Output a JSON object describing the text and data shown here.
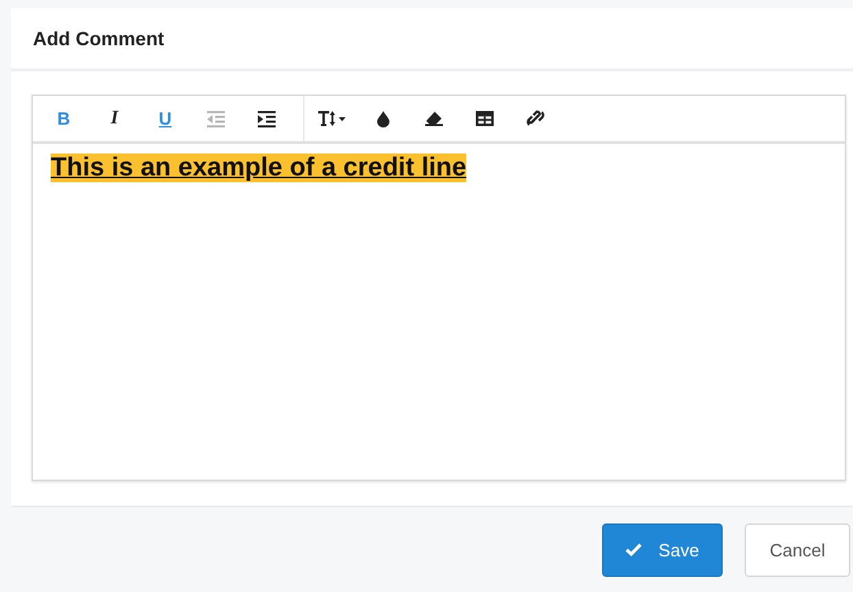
{
  "dialog": {
    "title": "Add Comment"
  },
  "toolbar": {
    "groups": [
      [
        {
          "kind": "bold",
          "label": "B",
          "active": true,
          "disabled": false
        },
        {
          "kind": "italic",
          "label": "I",
          "active": false,
          "disabled": false
        },
        {
          "kind": "underline",
          "label": "U",
          "active": true,
          "disabled": false
        },
        {
          "kind": "outdent",
          "active": false,
          "disabled": true
        },
        {
          "kind": "indent",
          "active": false,
          "disabled": false
        }
      ],
      [
        {
          "kind": "font-size",
          "active": false,
          "disabled": false
        },
        {
          "kind": "color",
          "active": false,
          "disabled": false
        },
        {
          "kind": "eraser",
          "active": false,
          "disabled": false
        },
        {
          "kind": "table",
          "active": false,
          "disabled": false
        },
        {
          "kind": "link",
          "active": false,
          "disabled": false
        }
      ]
    ]
  },
  "editor": {
    "text": "This is an example of a credit line",
    "highlighted": true
  },
  "buttons": [
    {
      "kind": "primary",
      "label": "Save"
    },
    {
      "kind": "secondary",
      "label": "Cancel"
    }
  ]
}
